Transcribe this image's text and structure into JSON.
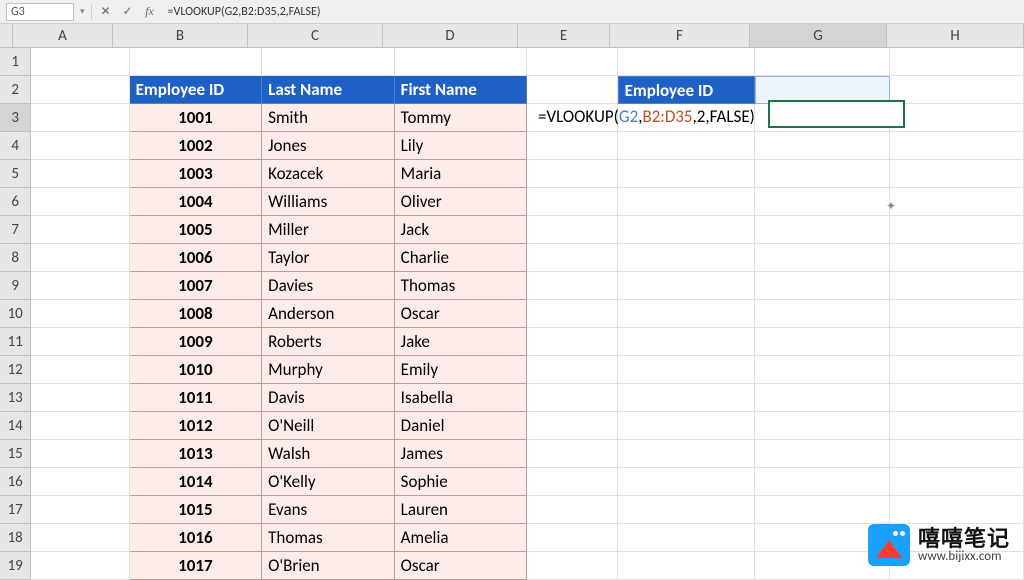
{
  "toolbar": {
    "name_box": "G3",
    "fx_label": "fx",
    "formula": "=VLOOKUP(G2,B2:D35,2,FALSE)"
  },
  "columns": [
    "A",
    "B",
    "C",
    "D",
    "E",
    "F",
    "G",
    "H"
  ],
  "col_widths": [
    "wA",
    "wB",
    "wC",
    "wD",
    "wE",
    "wF",
    "wG",
    "wH"
  ],
  "selected_col": "G",
  "selected_row": 3,
  "active_cell": "G3",
  "table": {
    "headers": {
      "id": "Employee ID",
      "last": "Last Name",
      "first": "First Name"
    },
    "rows": [
      {
        "id": "1001",
        "last": "Smith",
        "first": "Tommy"
      },
      {
        "id": "1002",
        "last": "Jones",
        "first": "Lily"
      },
      {
        "id": "1003",
        "last": "Kozacek",
        "first": "Maria"
      },
      {
        "id": "1004",
        "last": "Williams",
        "first": "Oliver"
      },
      {
        "id": "1005",
        "last": "Miller",
        "first": "Jack"
      },
      {
        "id": "1006",
        "last": "Taylor",
        "first": "Charlie"
      },
      {
        "id": "1007",
        "last": "Davies",
        "first": "Thomas"
      },
      {
        "id": "1008",
        "last": "Anderson",
        "first": "Oscar"
      },
      {
        "id": "1009",
        "last": "Roberts",
        "first": "Jake"
      },
      {
        "id": "1010",
        "last": "Murphy",
        "first": "Emily"
      },
      {
        "id": "1011",
        "last": "Davis",
        "first": "Isabella"
      },
      {
        "id": "1012",
        "last": "O'Neill",
        "first": "Daniel"
      },
      {
        "id": "1013",
        "last": "Walsh",
        "first": "James"
      },
      {
        "id": "1014",
        "last": "O'Kelly",
        "first": "Sophie"
      },
      {
        "id": "1015",
        "last": "Evans",
        "first": "Lauren"
      },
      {
        "id": "1016",
        "last": "Thomas",
        "first": "Amelia"
      },
      {
        "id": "1017",
        "last": "O'Brien",
        "first": "Oscar"
      }
    ]
  },
  "lookup": {
    "header": "Employee ID",
    "formula_parts": {
      "prefix": "=VLOOKUP(",
      "arg1": "G2",
      "sep1": ",",
      "arg2": "B2:D35",
      "sep2": ",",
      "arg3": "2",
      "sep3": ",",
      "arg4": "FALSE",
      "suffix": ")"
    }
  },
  "branding": {
    "title": "嘻嘻笔记",
    "url": "www.bijixx.com"
  }
}
